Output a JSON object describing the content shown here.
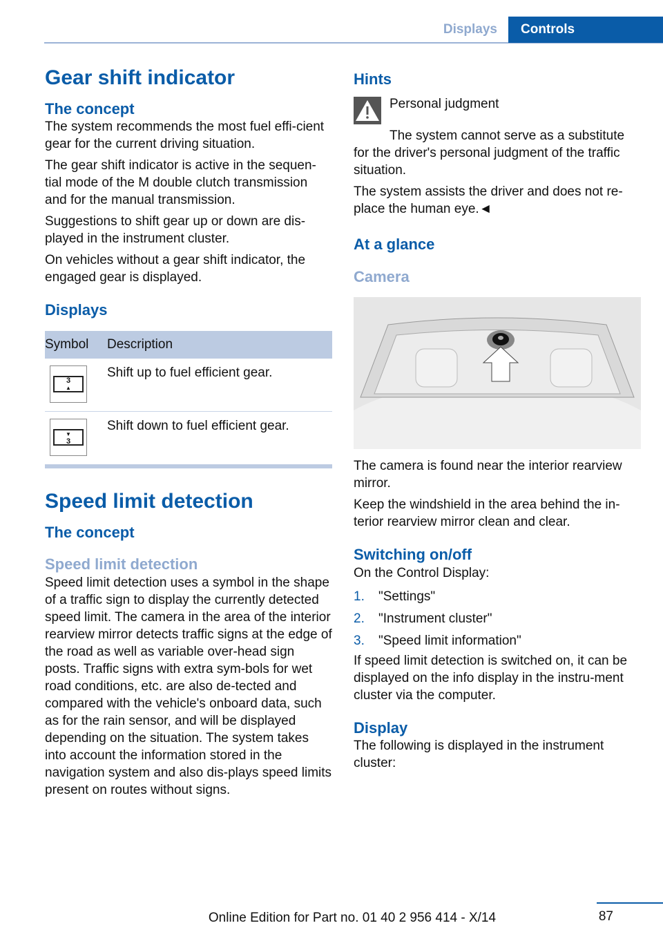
{
  "header": {
    "tab_section": "Displays",
    "tab_chapter": "Controls"
  },
  "left": {
    "title": "Gear shift indicator",
    "concept_heading": "The concept",
    "concept_paragraphs": [
      "The system recommends the most fuel effi-cient gear for the current driving situation.",
      "The gear shift indicator is active in the sequen-tial mode of the M double clutch transmission and for the manual transmission.",
      "Suggestions to shift gear up or down are dis-played in the instrument cluster.",
      "On vehicles without a gear shift indicator, the engaged gear is displayed."
    ],
    "displays_heading": "Displays",
    "table": {
      "headers": [
        "Symbol",
        "Description"
      ],
      "rows": [
        {
          "icon": "shift-up-icon",
          "gear": "3",
          "arrow": "▲",
          "description": "Shift up to fuel efficient gear."
        },
        {
          "icon": "shift-down-icon",
          "gear": "3",
          "arrow": "▼",
          "description": "Shift down to fuel efficient gear."
        }
      ]
    },
    "section2_title": "Speed limit detection",
    "section2_concept": "The concept",
    "section2_sub": "Speed limit detection",
    "section2_body": "Speed limit detection uses a symbol in the shape of a traffic sign to display the currently detected speed limit. The camera in the area of the interior rearview mirror detects traffic signs at the edge of the road as well as variable over-head sign posts. Traffic signs with extra sym-bols for wet road conditions, etc. are also de-tected and compared with the vehicle's onboard data, such as for the rain sensor, and will be displayed depending on the situation. The system takes into account the information stored in the navigation system and also dis-plays speed limits present on routes without signs."
  },
  "right": {
    "hints_heading": "Hints",
    "warning_title": "Personal judgment",
    "warning_text": "The system cannot serve as a substitute for the driver's personal judgment of the traffic situation.",
    "warning_text2": "The system assists the driver and does not re-place the human eye.◄",
    "glance_heading": "At a glance",
    "camera_heading": "Camera",
    "camera_paragraphs": [
      "The camera is found near the interior rearview mirror.",
      "Keep the windshield in the area behind the in-terior rearview mirror clean and clear."
    ],
    "switching_heading": "Switching on/off",
    "switching_intro": "On the Control Display:",
    "steps": [
      {
        "num": "1.",
        "text": "\"Settings\""
      },
      {
        "num": "2.",
        "text": "\"Instrument cluster\""
      },
      {
        "num": "3.",
        "text": "\"Speed limit information\""
      }
    ],
    "switching_after": "If speed limit detection is switched on, it can be displayed on the info display in the instru-ment cluster via the computer.",
    "display_heading": "Display",
    "display_text": "The following is displayed in the instrument cluster:"
  },
  "footer": {
    "edition": "Online Edition for Part no. 01 40 2 956 414 - X/14",
    "page": "87"
  }
}
